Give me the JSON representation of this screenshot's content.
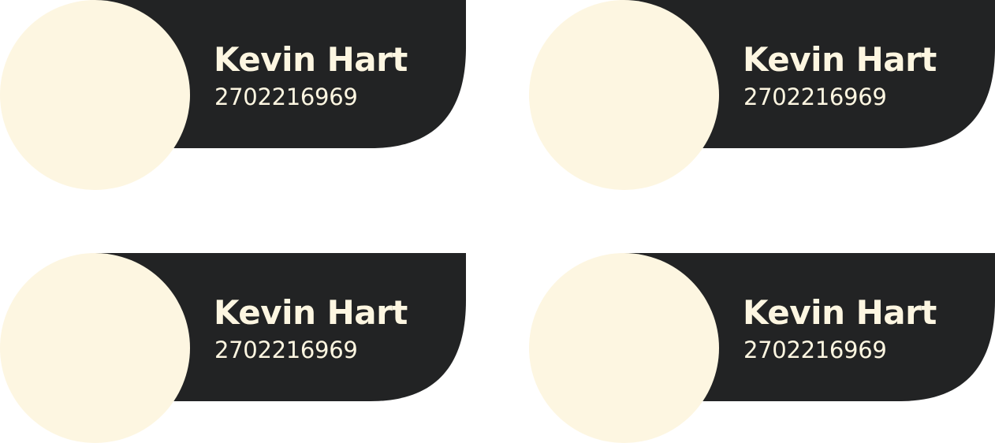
{
  "theme": {
    "card_color": "#222324",
    "avatar_color": "#FDF6E1",
    "text_color": "#FDF6E1"
  },
  "cards": [
    {
      "name": "Kevin Hart",
      "phone": "2702216969"
    },
    {
      "name": "Kevin Hart",
      "phone": "2702216969"
    },
    {
      "name": "Kevin Hart",
      "phone": "2702216969"
    },
    {
      "name": "Kevin Hart",
      "phone": "2702216969"
    }
  ]
}
